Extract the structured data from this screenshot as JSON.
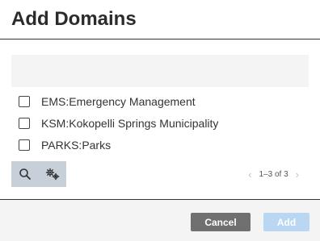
{
  "dialog": {
    "title": "Add Domains"
  },
  "filter": {
    "value": ""
  },
  "domains": [
    {
      "label": "EMS:Emergency Management",
      "checked": false
    },
    {
      "label": "KSM:Kokopelli Springs Municipality",
      "checked": false
    },
    {
      "label": "PARKS:Parks",
      "checked": false
    }
  ],
  "toolbar": {
    "search_icon": "search-icon",
    "settings_icon": "gear-icon"
  },
  "pager": {
    "range_text": "1–3 of 3",
    "prev_icon": "chevron-left-icon",
    "next_icon": "chevron-right-icon"
  },
  "footer": {
    "cancel_label": "Cancel",
    "add_label": "Add"
  },
  "colors": {
    "cancel_bg": "#707070",
    "add_bg_disabled": "#b9d6f2",
    "toolbar_bg": "#c7cfd8"
  }
}
